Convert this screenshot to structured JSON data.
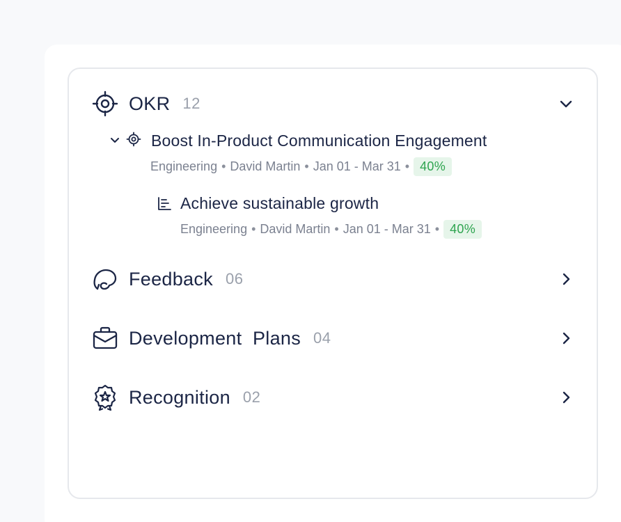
{
  "okr": {
    "title": "OKR",
    "count": "12",
    "items": [
      {
        "title": "Boost In-Product Communication Engagement",
        "team": "Engineering",
        "owner": "David Martin",
        "dates": "Jan 01 - Mar 31",
        "progress": "40%",
        "progress_value": 0.4
      },
      {
        "title": "Achieve sustainable growth",
        "team": "Engineering",
        "owner": "David Martin",
        "dates": "Jan 01 - Mar 31",
        "progress": "40%",
        "progress_value": 0.4
      }
    ]
  },
  "sections": [
    {
      "title": "Feedback",
      "count": "06",
      "icon": "chat-bubbles-icon"
    },
    {
      "title": "Development  Plans",
      "count": "04",
      "icon": "briefcase-icon"
    },
    {
      "title": "Recognition",
      "count": "02",
      "icon": "award-badge-icon"
    }
  ],
  "separator": "•",
  "colors": {
    "text": "#1b2545",
    "muted": "#7b8190",
    "count": "#9aa0ab",
    "progress_bg": "#e6f5ea",
    "progress_text": "#2ea44f",
    "border": "#e6e8ec"
  }
}
